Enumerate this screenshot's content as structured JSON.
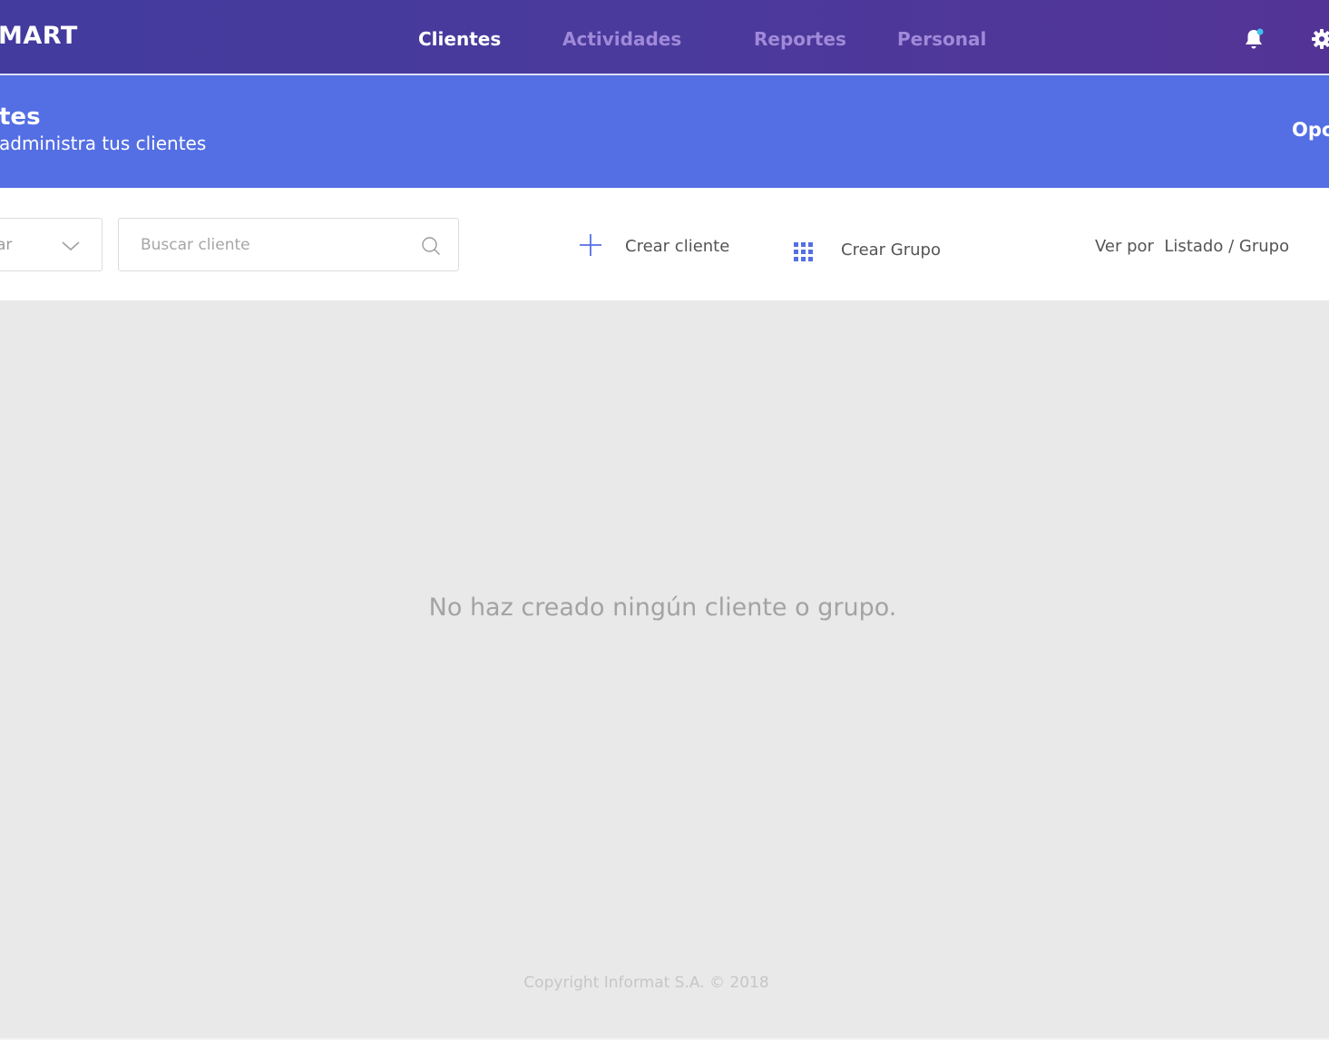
{
  "app": {
    "logo_text": "MART"
  },
  "nav": {
    "tabs": [
      {
        "label": "Clientes",
        "active": true
      },
      {
        "label": "Actividades",
        "active": false
      },
      {
        "label": "Reportes",
        "active": false
      },
      {
        "label": "Personal",
        "active": false
      }
    ],
    "icons": {
      "notifications": "bell-icon",
      "settings": "gear-icon"
    },
    "notification_dot_color": "#3fc3ee"
  },
  "subheader": {
    "title": "tes",
    "subtitle": "administra tus clientes",
    "options_label": "Opc"
  },
  "toolbar": {
    "filter_value": "rar",
    "search_placeholder": "Buscar cliente",
    "create_client_label": "Crear cliente",
    "create_group_label": "Crear Grupo",
    "view_by_label": "Ver por",
    "view_option_list": "Listado",
    "view_separator": "/",
    "view_option_group": "Grupo",
    "accent_color": "#546fe3"
  },
  "main": {
    "empty_message": "No haz creado ningún cliente o grupo."
  },
  "footer": {
    "copyright": "Copyright Informat S.A. © 2018"
  },
  "colors": {
    "topbar": "#4a3a9c",
    "subheader": "#546fe3",
    "background": "#e9e9e9"
  }
}
